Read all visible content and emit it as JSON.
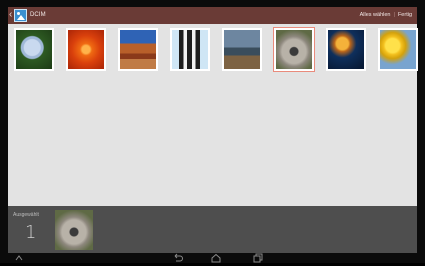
{
  "actionbar": {
    "title": "DCIM",
    "select_all_label": "Alles wählen",
    "separator": "|",
    "done_label": "Fertig",
    "background": "#6a3b36"
  },
  "gallery": {
    "items": [
      {
        "name": "hydrangea",
        "selected": false
      },
      {
        "name": "chrysanthemum",
        "selected": false
      },
      {
        "name": "desert",
        "selected": false
      },
      {
        "name": "penguins",
        "selected": false
      },
      {
        "name": "lighthouse",
        "selected": false
      },
      {
        "name": "koala",
        "selected": true
      },
      {
        "name": "jellyfish",
        "selected": false
      },
      {
        "name": "tulips",
        "selected": false
      }
    ],
    "selection_color": "#e98b7c"
  },
  "selection_panel": {
    "label": "Ausgewählt",
    "count": "1"
  },
  "navbar": {
    "icons": [
      "expand-up-icon",
      "back-icon",
      "home-icon",
      "recent-apps-icon"
    ]
  }
}
